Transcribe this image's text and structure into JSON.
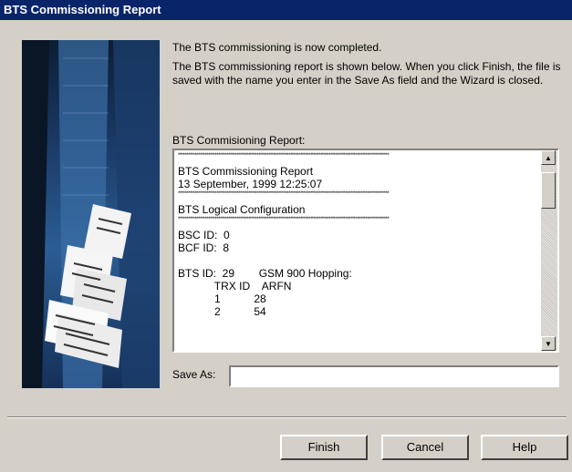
{
  "window": {
    "title": "BTS Commissioning Report"
  },
  "intro": {
    "line1": "The BTS commissioning is now completed.",
    "line2": "The BTS commissioning report is shown below. When you click Finish, the file is saved with the name you enter in the Save As field and the Wizard is closed."
  },
  "report": {
    "label": "BTS Commisioning Report:",
    "separator": "******************************************************************************************************************************",
    "lines": [
      "BTS Commissioning Report",
      "13 September, 1999 12:25:07",
      "BTS Logical Configuration",
      "BSC ID:  0",
      "BCF ID:  8",
      "BTS ID:  29        GSM 900 Hopping:",
      "            TRX ID    ARFN",
      "            1           28",
      "            2           54"
    ]
  },
  "save_as": {
    "label": "Save As:",
    "value": ""
  },
  "buttons": {
    "finish": "Finish",
    "cancel": "Cancel",
    "help": "Help"
  },
  "icons": {
    "scroll_up": "scroll-up-arrow-icon",
    "scroll_down": "scroll-down-arrow-icon"
  }
}
